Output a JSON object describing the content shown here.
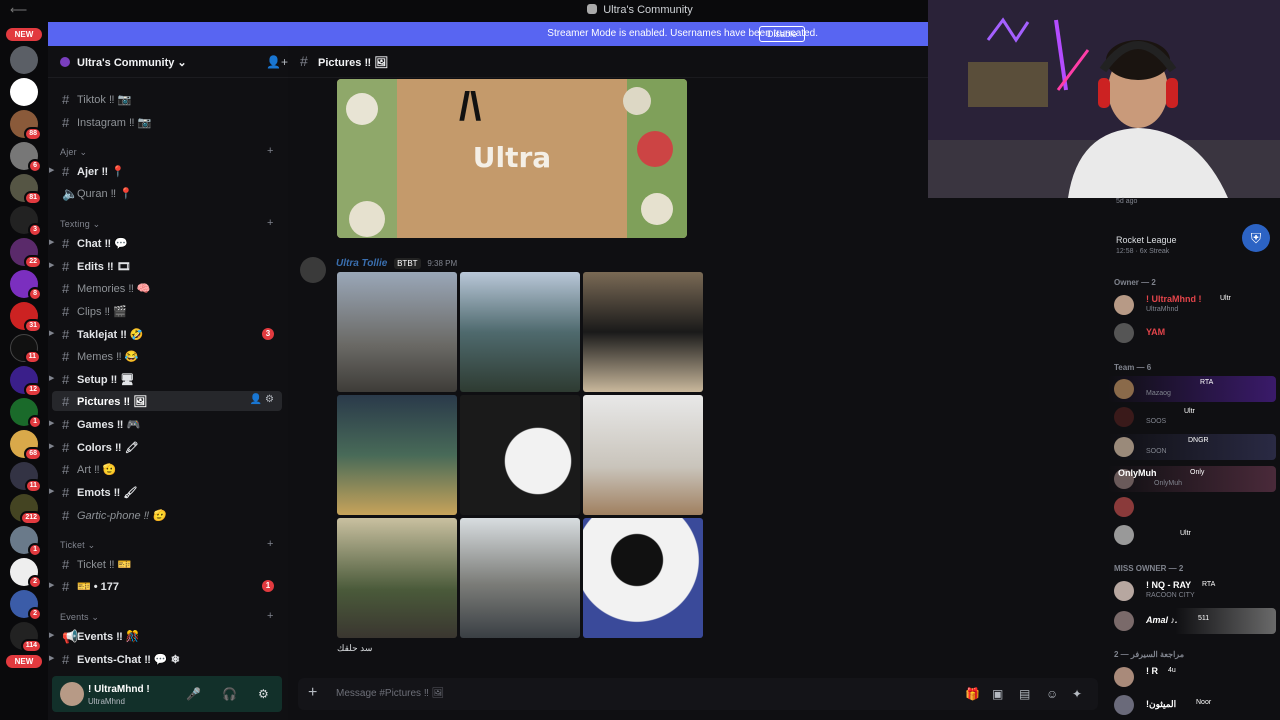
{
  "window": {
    "title": "Ultra's Community"
  },
  "streamer_banner": {
    "text": "Streamer Mode is enabled. Usernames have been truncated.",
    "button": "Disable"
  },
  "rail": {
    "new_top": "NEW",
    "new_bottom": "NEW",
    "badges": [
      "88",
      "6",
      "81",
      "3",
      "22",
      "8",
      "31",
      "11",
      "12",
      "1",
      "68",
      "11",
      "212",
      "1",
      "2",
      "2",
      "114"
    ]
  },
  "guild": {
    "name": "Ultra's Community ⌄"
  },
  "channels": {
    "tiktok": "Tiktok ‼ 📷",
    "instagram": "Instagram ‼ 📷",
    "cat_ajer": "Ajer ⌄",
    "ajer": "Ajer ‼ 📍",
    "quran": "Quran ‼ 📍",
    "cat_texting": "Texting ⌄",
    "chat": "Chat ‼ 💬",
    "edits": "Edits ‼ 🎞",
    "memories": "Memories ‼ 🧠",
    "clips": "Clips ‼ 🎬",
    "taklejat": "Taklejat ‼ 🤣",
    "taklejat_badge": "3",
    "memes": "Memes ‼ 😂",
    "setup": "Setup ‼ 🖥",
    "pictures": "Pictures ‼ 🖼",
    "games": "Games ‼ 🎮",
    "colors": "Colors ‼ 🖍",
    "art": "Art ‼ 🫡",
    "emots": "Emots ‼ 🖌",
    "gartic": "Gartic-phone ‼ 🫡",
    "cat_ticket": "Ticket ⌄",
    "ticket": "Ticket ‼ 🎫",
    "ticket_177": "🎫 • 177",
    "ticket_badge": "1",
    "cat_events": "Events ⌄",
    "events": "Events ‼ 🎊",
    "events_chat": "Events-Chat ‼ 💬 ❄"
  },
  "user_panel": {
    "name": "! UltraMhnd !",
    "status": "UltraMhnd"
  },
  "main": {
    "channel_name": "Pictures ‼ 🖼",
    "banner_word": "Ultra",
    "banner_mark": "/\\",
    "author": "Ultra Tollie",
    "author_tag": "BTBT",
    "time": "9:38 PM",
    "caption": "سد حلقك",
    "composer_placeholder": "Message #Pictures ‼ 🖼"
  },
  "members": {
    "activity_top": "5d ago",
    "activity_game": "Rocket League",
    "activity_detail": "12:58 · 6x Streak",
    "owner_header": "Owner — 2",
    "owner1_name": "! UltraMhnd !",
    "owner1_tag": "Ultr",
    "owner1_sub": "UltraMhnd",
    "owner2_name": "YAM",
    "team_header": "Team — 6",
    "team1_tag": "RTA",
    "team1_sub": "Mazaog",
    "team2_tag": "Ultr",
    "team3_sub": "SOOS",
    "team4_tag": "DNGR",
    "team4_sub": "SOON",
    "team5_name": "OnlyMuh",
    "team5_tag": "Only",
    "team5_sub": "OnlyMuh",
    "team6_tag": "Ultr",
    "miss_header": "MISS OWNER — 2",
    "miss1_name": "! NQ - RAY",
    "miss1_tag": "RTA",
    "miss1_sub": "RACOON CITY",
    "miss2_name": "Amal ♪.",
    "miss2_tag": "511",
    "arabic_header": "مراجعة السيرفر — 2",
    "ar1_name": "! R",
    "ar1_tag": "4u",
    "ar2_name": "!الميثون",
    "ar2_tag": "Noor"
  }
}
